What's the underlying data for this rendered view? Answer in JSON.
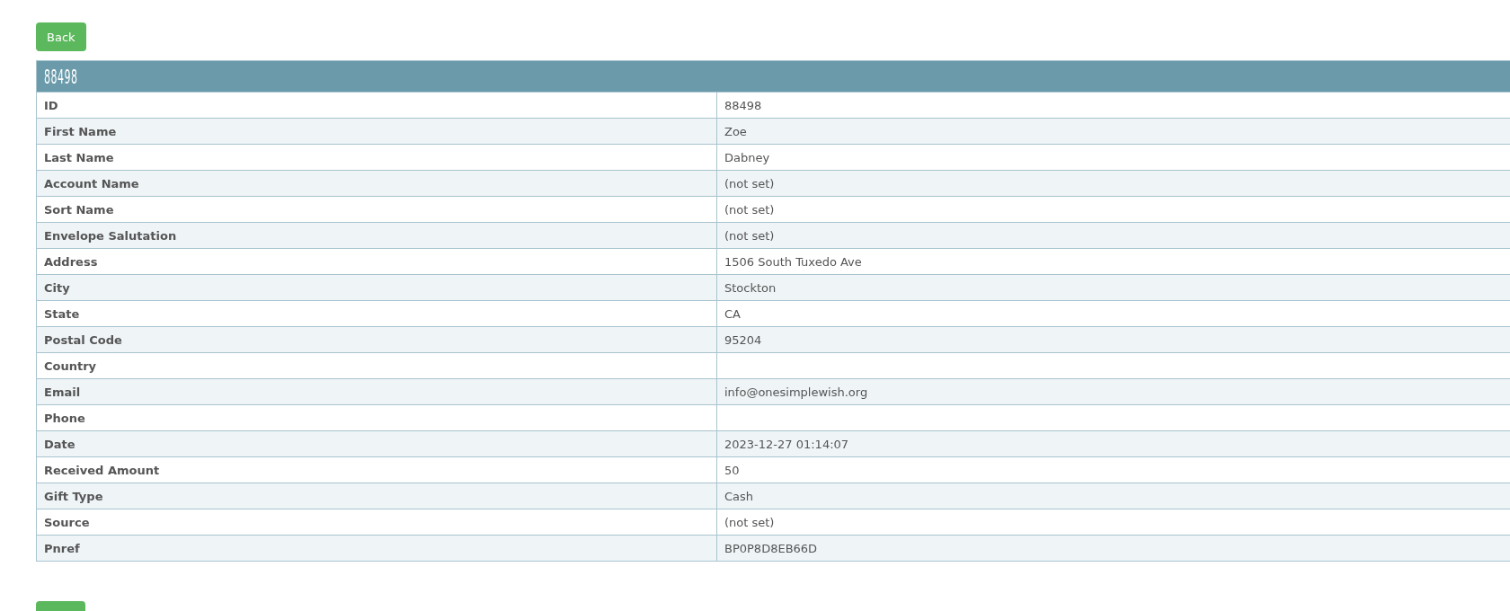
{
  "back_button": {
    "label": "Back"
  },
  "table": {
    "header": "88498",
    "rows": [
      {
        "label": "ID",
        "value": "88498"
      },
      {
        "label": "First Name",
        "value": "Zoe"
      },
      {
        "label": "Last Name",
        "value": "Dabney"
      },
      {
        "label": "Account Name",
        "value": "(not set)"
      },
      {
        "label": "Sort Name",
        "value": "(not set)"
      },
      {
        "label": "Envelope Salutation",
        "value": "(not set)"
      },
      {
        "label": "Address",
        "value": "1506 South Tuxedo Ave"
      },
      {
        "label": "City",
        "value": "Stockton"
      },
      {
        "label": "State",
        "value": "CA"
      },
      {
        "label": "Postal Code",
        "value": "95204"
      },
      {
        "label": "Country",
        "value": ""
      },
      {
        "label": "Email",
        "value": "info@onesimplewish.org"
      },
      {
        "label": "Phone",
        "value": ""
      },
      {
        "label": "Date",
        "value": "2023-12-27 01:14:07"
      },
      {
        "label": "Received Amount",
        "value": "50"
      },
      {
        "label": "Gift Type",
        "value": "Cash"
      },
      {
        "label": "Source",
        "value": "(not set)"
      },
      {
        "label": "Pnref",
        "value": "BP0P8D8EB66D"
      }
    ]
  }
}
